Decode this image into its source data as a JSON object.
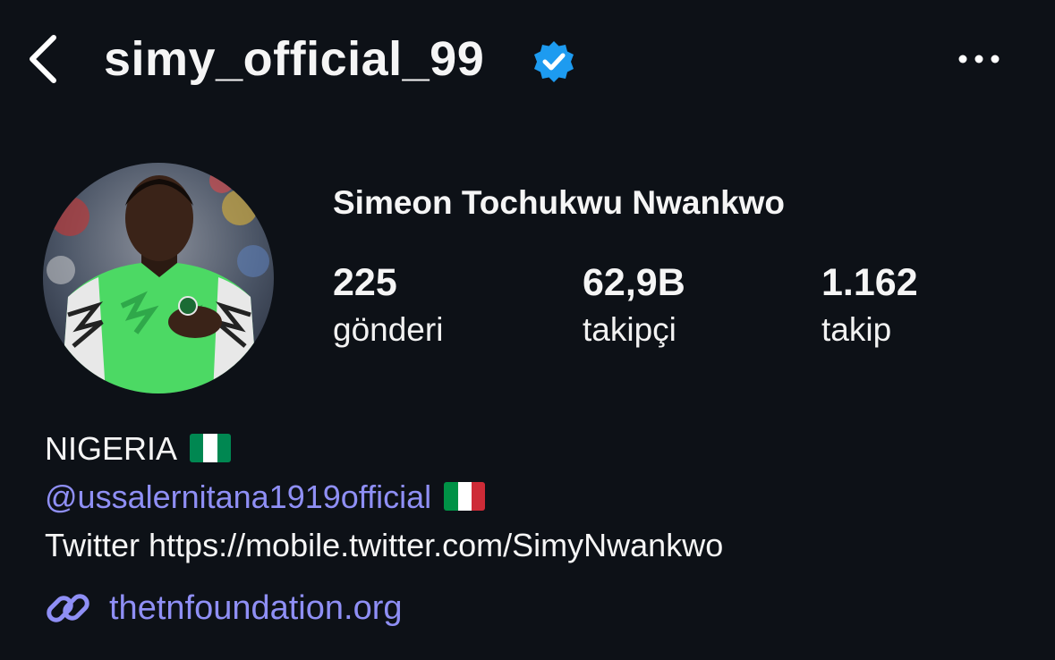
{
  "header": {
    "back_icon": "chevron-left-icon",
    "username": "simy_official_99",
    "verified_icon": "verified-badge-icon",
    "more_icon": "more-horizontal-icon"
  },
  "profile": {
    "full_name": "Simeon Tochukwu Nwankwo",
    "stats": [
      {
        "value": "225",
        "label": "gönderi"
      },
      {
        "value": "62,9B",
        "label": "takipçi"
      },
      {
        "value": "1.162",
        "label": "takip"
      }
    ]
  },
  "bio": {
    "line1": "NIGERIA",
    "line1_flag": "nigeria-flag",
    "mention": "@ussalernitana1919official",
    "mention_flag": "italy-flag",
    "line3": "Twitter https://mobile.twitter.com/SimyNwankwo",
    "link_icon": "link-icon",
    "link": "thetnfoundation.org"
  },
  "colors": {
    "background": "#0d1117",
    "text": "#f5f5f5",
    "link": "#8f8ff5",
    "verified": "#1d9bf0",
    "nigeria_green": "#008751",
    "italy_green": "#009246",
    "italy_red": "#ce2b37"
  }
}
